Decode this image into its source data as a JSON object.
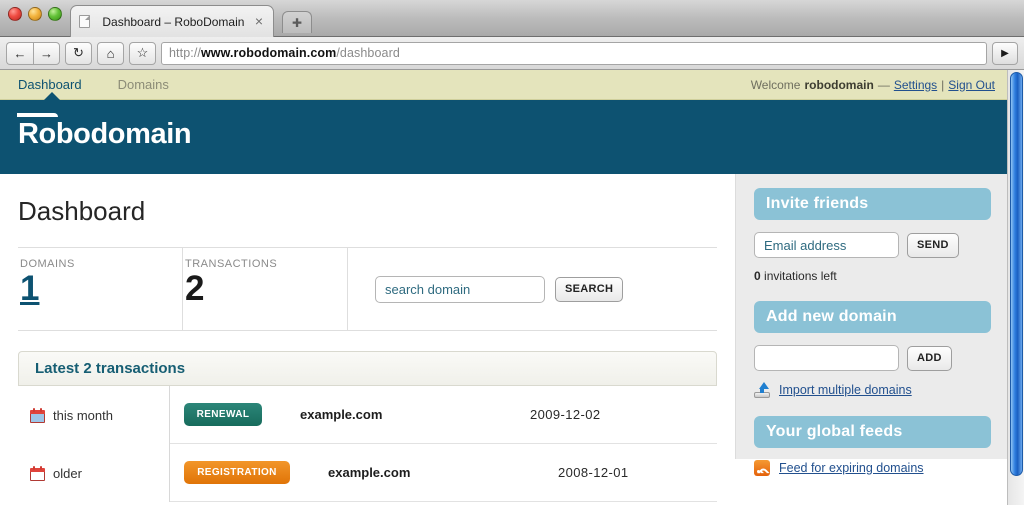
{
  "browser": {
    "tab": {
      "title": "Dashboard – RoboDomain",
      "close_label": "×",
      "favicon_icon": "page-icon"
    },
    "new_tab_label": "✚",
    "toolbar": {
      "back_icon": "←",
      "forward_icon": "→",
      "reload_icon": "↻",
      "home_icon": "⌂",
      "bookmark_icon": "☆",
      "go_icon": "▶"
    },
    "url": {
      "scheme": "http://",
      "host": "www.robodomain.com",
      "path": "/dashboard"
    }
  },
  "utilnav": {
    "items": [
      {
        "label": "Dashboard",
        "active": true
      },
      {
        "label": "Domains",
        "active": false
      }
    ],
    "welcome_prefix": "Welcome",
    "username": "robodomain",
    "separator": "—",
    "settings_label": "Settings",
    "pipe": "|",
    "signout_label": "Sign Out"
  },
  "brand": {
    "logo_first": "Ro",
    "logo_rest": "bodomain"
  },
  "main": {
    "page_title": "Dashboard",
    "stats": [
      {
        "label": "DOMAINS",
        "value": "1",
        "is_link": true
      },
      {
        "label": "TRANSACTIONS",
        "value": "2",
        "is_link": false
      }
    ],
    "search": {
      "placeholder": "search domain",
      "value": "",
      "button_label": "SEARCH"
    },
    "transactions_panel": {
      "heading": "Latest 2 transactions",
      "rows": [
        {
          "when": "this month",
          "calendar": "calendar-filled-icon",
          "type": "RENEWAL",
          "type_class": "renewal",
          "domain": "example.com",
          "date": "2009-12-02"
        },
        {
          "when": "older",
          "calendar": "calendar-empty-icon",
          "type": "REGISTRATION",
          "type_class": "registration",
          "domain": "example.com",
          "date": "2008-12-01"
        }
      ]
    }
  },
  "sidebar": {
    "invite": {
      "heading": "Invite friends",
      "email_placeholder": "Email address",
      "email_value": "",
      "send_label": "SEND",
      "count": "0",
      "count_text": "invitations left"
    },
    "add_domain": {
      "heading": "Add new domain",
      "domain_placeholder": "",
      "domain_value": "",
      "add_label": "ADD",
      "import_link": "Import multiple domains",
      "import_icon": "upload-icon"
    },
    "feeds": {
      "heading": "Your global feeds",
      "feed_link": "Feed for expiring domains",
      "feed_icon": "rss-icon"
    }
  },
  "colors": {
    "brand_dark": "#0d5271",
    "nav_bg": "#e4e4bc",
    "sidebar_heading": "#8bc2d6",
    "badge_renewal": "#176b5c",
    "badge_registration": "#e07407",
    "link": "#22508e",
    "scrollbar_thumb": "#2f7fe0"
  }
}
